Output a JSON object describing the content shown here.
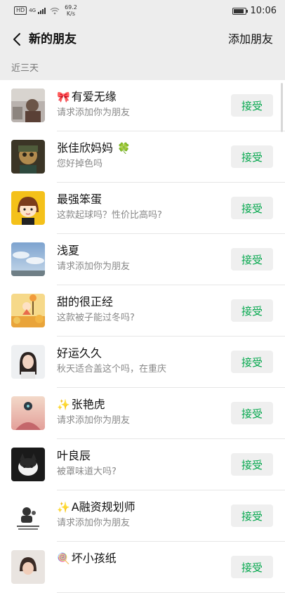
{
  "status_bar": {
    "hd_badge": "HD",
    "network": "4G",
    "speed_value": "69.2",
    "speed_unit": "K/s",
    "time": "10:06",
    "battery_level": 0.9
  },
  "nav": {
    "title": "新的朋友",
    "action": "添加朋友"
  },
  "section": {
    "label": "近三天"
  },
  "accept_label": "接受",
  "requests": [
    {
      "deco": "🎀",
      "name": "有爱无缘",
      "msg": "请求添加你为朋友",
      "avatar": "photo-woman-car"
    },
    {
      "deco_after": "🍀",
      "name": "张佳欣妈妈",
      "msg": "您好掉色吗",
      "avatar": "photo-child-dark"
    },
    {
      "name": "最强笨蛋",
      "msg": "这款起球吗？性价比高吗?",
      "avatar": "cartoon-girl"
    },
    {
      "name": "浅夏",
      "msg": "请求添加你为朋友",
      "avatar": "photo-sky"
    },
    {
      "name": "甜的很正经",
      "msg": "这款被子能过冬吗?",
      "avatar": "cartoon-autumn"
    },
    {
      "name": "好运久久",
      "msg": "秋天适合盖这个吗，在重庆",
      "avatar": "photo-woman"
    },
    {
      "deco": "✨",
      "name": "张艳虎",
      "msg": "请求添加你为朋友",
      "avatar": "art-pink-sky"
    },
    {
      "name": "叶良辰",
      "msg": "被罩味道大吗?",
      "avatar": "photo-cat-dark"
    },
    {
      "deco": "✨",
      "name": "A融资规划师",
      "msg": "请求添加你为朋友",
      "avatar": "logo-finance"
    },
    {
      "deco": "🍭",
      "name": "坏小孩纸",
      "msg": "",
      "avatar": "photo-partial"
    }
  ]
}
